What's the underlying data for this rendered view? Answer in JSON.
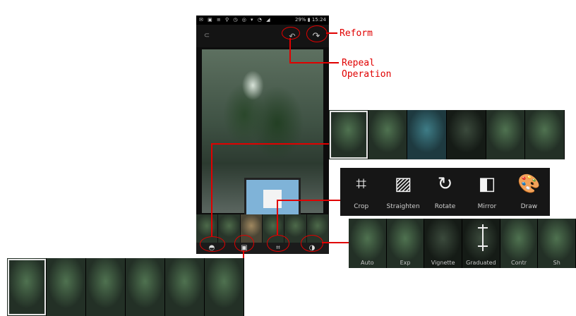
{
  "phone": {
    "status_left": "✉ ▣ ≡ ⚲   ◷ ◎ ▾ ◔ ◢",
    "status_right": "29% ▮ 15:24",
    "back_icon": "⊂",
    "undo_icon": "↶",
    "redo_icon": "↷",
    "toolbar_icons": [
      "◓",
      "▣",
      "⌗",
      "◑"
    ]
  },
  "callouts": {
    "reform": "Reform",
    "repeal_line1": "Repeal",
    "repeal_line2": "Operation"
  },
  "filters_panel": {
    "items": [
      "",
      "",
      "",
      "",
      "",
      ""
    ]
  },
  "tools_panel": {
    "items": [
      {
        "label": "Crop",
        "icon": "⌗"
      },
      {
        "label": "Straighten",
        "icon": "▨"
      },
      {
        "label": "Rotate",
        "icon": "↻"
      },
      {
        "label": "Mirror",
        "icon": "◧"
      },
      {
        "label": "Draw",
        "icon": "🎨"
      }
    ]
  },
  "adjust_panel": {
    "items": [
      "Auto",
      "Exp",
      "Vignette",
      "Graduated",
      "Contr",
      "Sh"
    ]
  },
  "frames_panel": {
    "items": [
      "",
      "",
      "",
      "",
      "",
      ""
    ]
  },
  "colors": {
    "accent_red": "#e00000"
  }
}
